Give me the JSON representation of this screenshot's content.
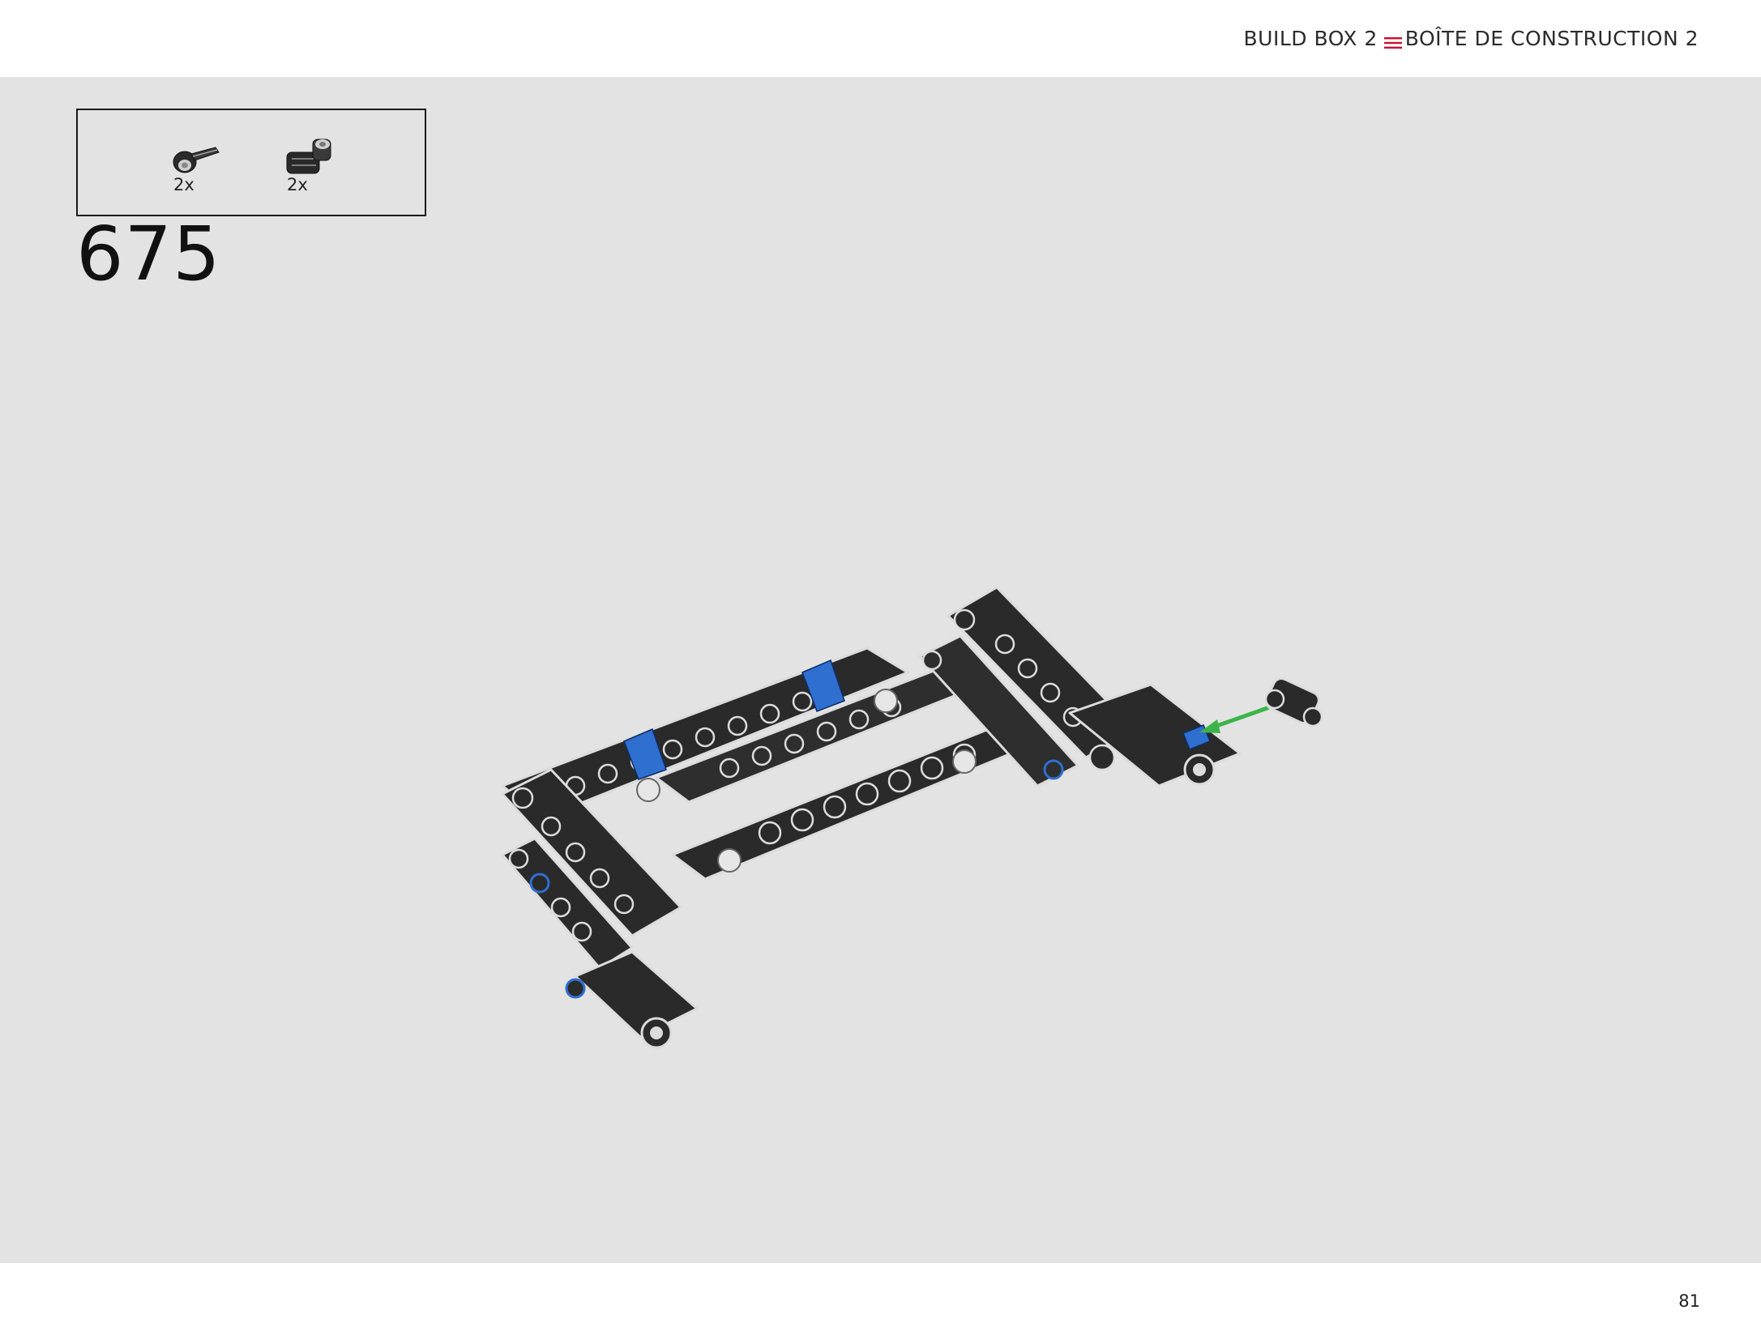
{
  "header": {
    "title_en": "BUILD BOX 2",
    "title_fr": "BOÎTE DE CONSTRUCTION 2",
    "separator_icon": "triple-line-icon",
    "separator_color": "#c8102e"
  },
  "parts_callout": {
    "parts": [
      {
        "icon": "technic-axle-pin-connector-icon",
        "quantity": "2x",
        "color": "#2a2a2a"
      },
      {
        "icon": "technic-pin-connector-perpendicular-icon",
        "quantity": "2x",
        "color": "#2a2a2a"
      }
    ]
  },
  "step": {
    "number": "675"
  },
  "model": {
    "description_icon": "lego-technic-chassis-assembly-icon",
    "beam_color": "#2a2a2a",
    "pin_color": "#2f6fd0",
    "arrow_color": "#3cb44b"
  },
  "footer": {
    "page_number": "81"
  }
}
